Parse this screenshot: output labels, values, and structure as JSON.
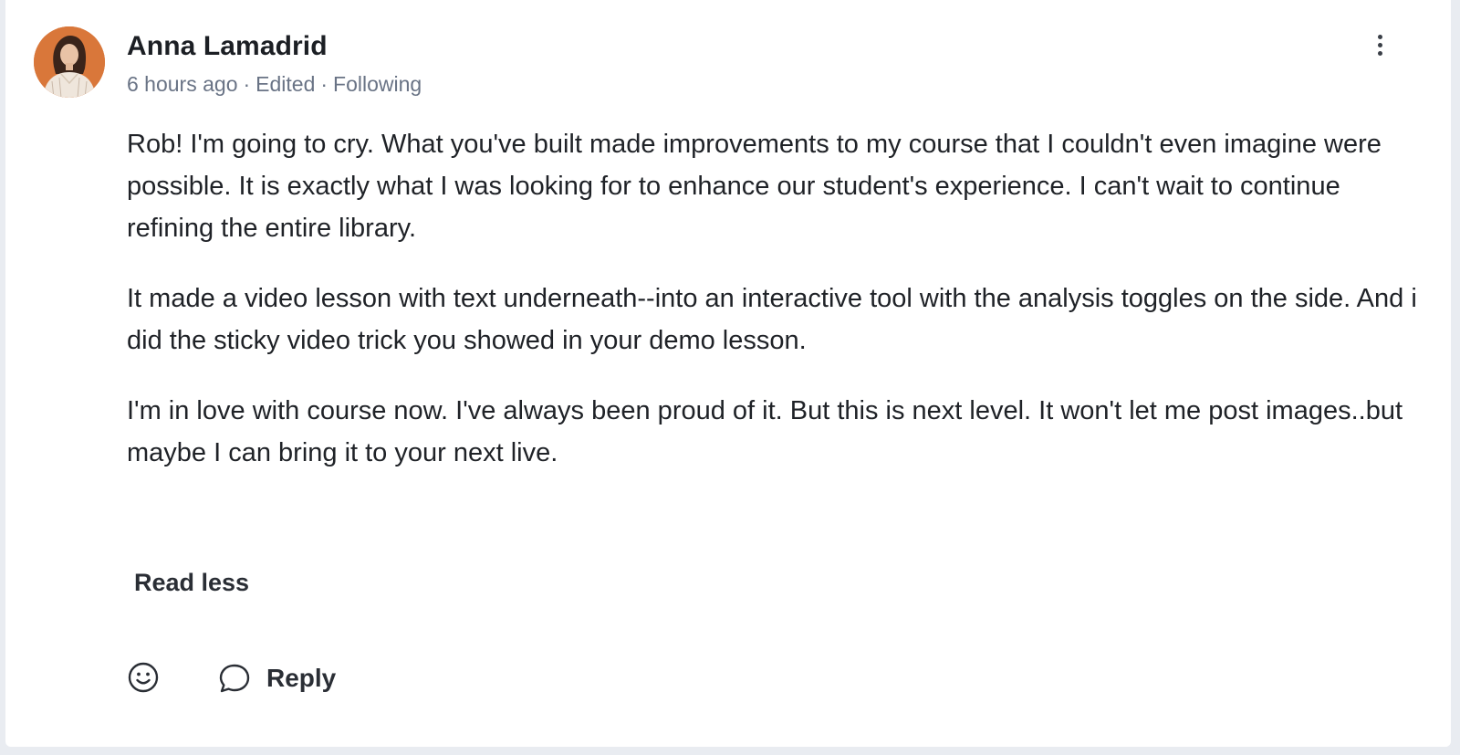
{
  "comment": {
    "author": "Anna Lamadrid",
    "meta": {
      "time": "6 hours ago",
      "edited": "Edited",
      "following": "Following",
      "separator": "·"
    },
    "paragraphs": [
      "Rob! I'm going to cry. What you've built made improvements to my course that I couldn't even imagine were possible. It is exactly what I was looking for to enhance our student's experience. I can't wait to continue refining the entire library.",
      "It made a video lesson with text underneath--into an interactive tool with the analysis toggles on the side. And i did the sticky video trick you showed in your demo lesson.",
      "I'm in love with course now. I've always been proud of it. But this is next level. It won't let me post images..but maybe I can bring it to your next live."
    ],
    "read_less_label": "Read less"
  },
  "actions": {
    "react_icon": "smiley-icon",
    "reply_icon": "speech-bubble-icon",
    "reply_label": "Reply",
    "more_icon": "vertical-ellipsis-icon"
  },
  "colors": {
    "text_primary": "#1f2227",
    "text_meta": "#697385",
    "avatar_bg": "#d9773a",
    "page_bg": "#e9ecf1"
  }
}
